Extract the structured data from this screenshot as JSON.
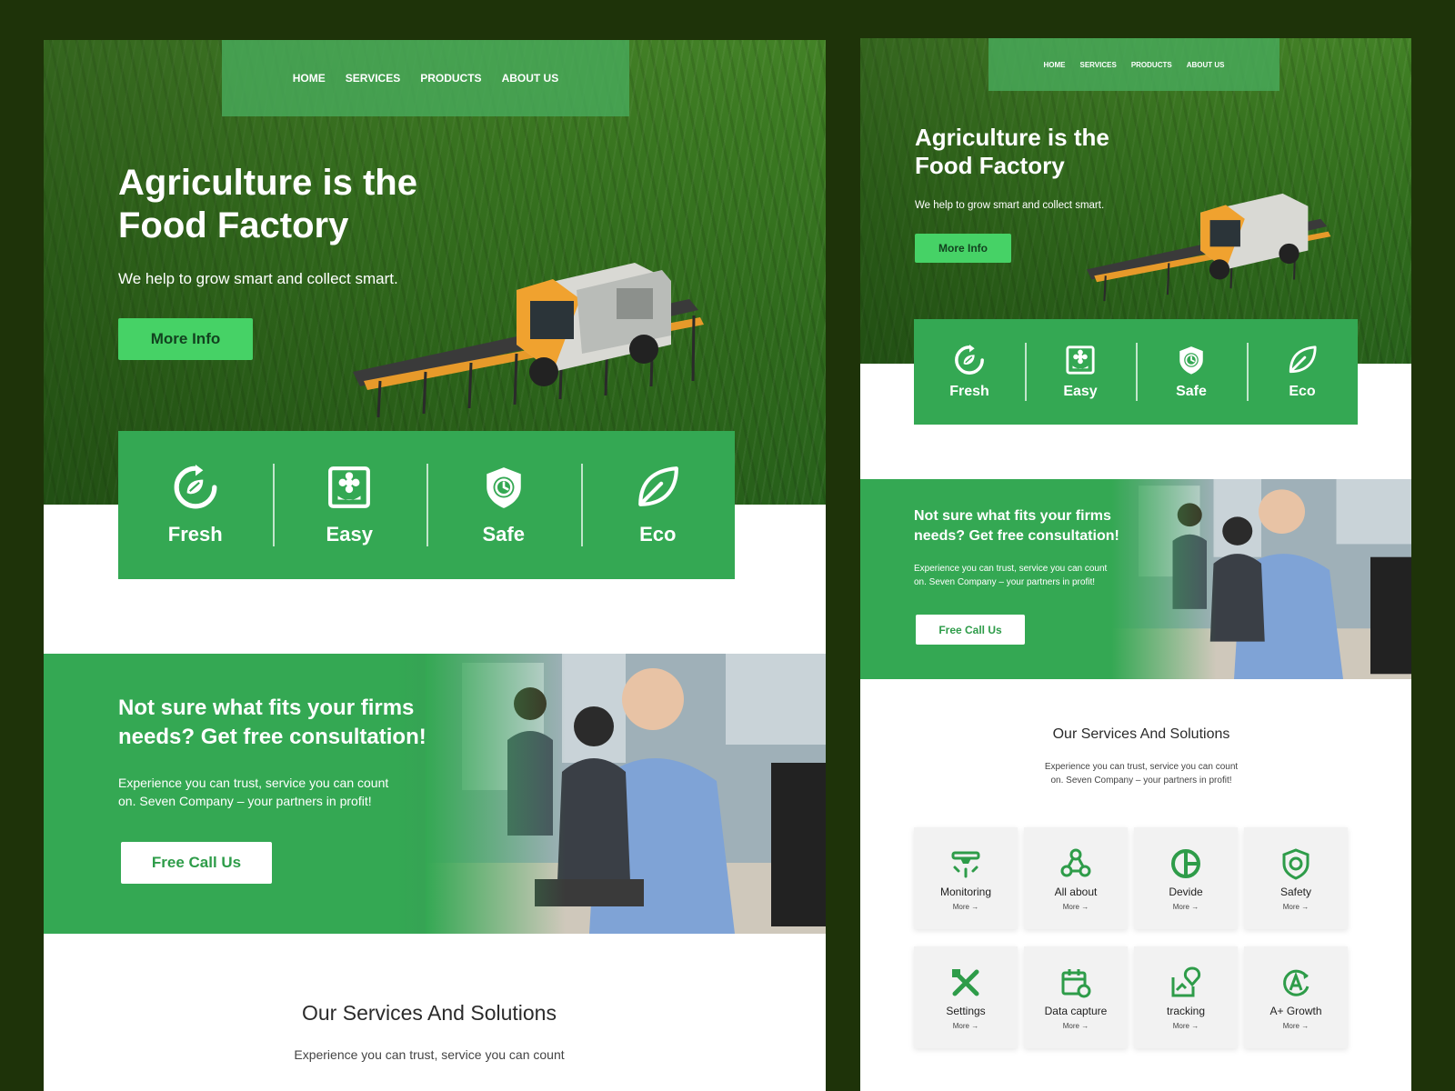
{
  "nav": [
    "HOME",
    "SERVICES",
    "PRODUCTS",
    "ABOUT US"
  ],
  "hero": {
    "title_line1": "Agriculture is the",
    "title_line2": "Food Factory",
    "subtitle": "We help to grow smart and collect smart.",
    "button": "More Info"
  },
  "features": [
    {
      "label": "Fresh",
      "icon": "recycle-leaf-icon"
    },
    {
      "label": "Easy",
      "icon": "flower-box-icon"
    },
    {
      "label": "Safe",
      "icon": "shield-clock-icon"
    },
    {
      "label": "Eco",
      "icon": "leaf-icon"
    }
  ],
  "consult": {
    "title_line1": "Not sure what fits your firms",
    "title_line2": "needs? Get free consultation!",
    "text_line1": "Experience you can trust, service you can count",
    "text_line2": "on. Seven Company – your partners in profit!",
    "button": "Free Call Us"
  },
  "services": {
    "title": "Our Services And Solutions",
    "text_line1": "Experience you can trust, service you can count",
    "text_line2": "on. Seven Company – your partners in profit!",
    "more_label": "More →",
    "cards": [
      {
        "label": "Monitoring",
        "icon": "monitoring-icon"
      },
      {
        "label": "All about",
        "icon": "network-icon"
      },
      {
        "label": "Devide",
        "icon": "pie-chart-icon"
      },
      {
        "label": "Safety",
        "icon": "shield-icon"
      },
      {
        "label": "Settings",
        "icon": "tools-icon"
      },
      {
        "label": "Data capture",
        "icon": "calendar-refresh-icon"
      },
      {
        "label": "tracking",
        "icon": "location-map-icon"
      },
      {
        "label": "A+ Growth",
        "icon": "grade-growth-icon"
      }
    ]
  },
  "colors": {
    "page_background": "#1e3309",
    "brand_green": "#34a853",
    "button_green": "#46d266",
    "nav_green": "#48aa5a"
  }
}
